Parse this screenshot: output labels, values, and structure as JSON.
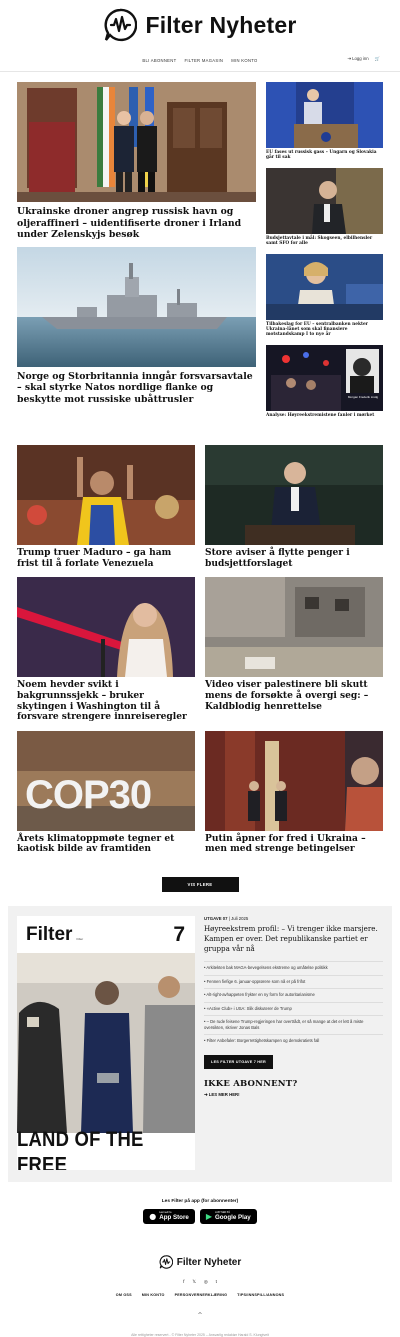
{
  "brand": {
    "name": "Filter Nyheter"
  },
  "nav": {
    "items": [
      "BLI ABONNENT",
      "FILTER MAGASIN",
      "MIN KONTO"
    ],
    "login": "Logg inn"
  },
  "top": {
    "lead": [
      {
        "title": "Ukrainske droner angrep russisk havn og oljeraffineri – uidentifiserte droner i Irland under Zelenskyjs besøk"
      },
      {
        "title": "Norge og Storbritannia inngår forsvarsavtale – skal styrke Natos nordlige flanke og beskytte mot russiske ubåttrusler"
      }
    ],
    "side": [
      {
        "title": "EU fases ut russisk gass – Ungarn og Slovakia går til sak"
      },
      {
        "title": "Budsjettavtale i mål: Skogseen, elbilhensler samt SFO for alle"
      },
      {
        "title": "Tilbakeslag for EU – sentralbanken nekter Ukraina-lånet som skal finansiere motstandskamp I to nye år"
      },
      {
        "title": "Analyse: Høyreekstremistene fanler i mørket",
        "caption": "Morgan Frederik Lindg"
      }
    ]
  },
  "grid": [
    {
      "title": "Trump truer Maduro – ga ham frist til å forlate Venezuela"
    },
    {
      "title": "Store aviser å flytte penger i budsjettforslaget"
    },
    {
      "title": "Noem hevder svikt i bakgrunnssjekk – bruker skytingen i Washington til å forsvare strengere innreiseregler"
    },
    {
      "title": "Video viser palestinere bli skutt mens de forsøkte å overgi seg: – Kaldblodig henrettelse"
    },
    {
      "title": "Årets klimatoppmøte tegner et kaotisk bilde av framtiden",
      "logo": "COP30"
    },
    {
      "title": "Putin åpner for fred i Ukraina – men med strenge betingelser"
    }
  ],
  "more_button": "VIS FLERE",
  "magazine": {
    "cover_brand": "Filter",
    "cover_sub": "Filter",
    "cover_number": "7",
    "cover_banner": "LAND OF THE FREE",
    "issue_label": "UTGAVE 07",
    "issue_date": "Juli 2025",
    "headline": "Høyreekstrem profil: – Vi trenger ikke marsjere. Kampen er over. Det republikanske partiet er gruppa vår nå",
    "toc": [
      "• Arkitekten bak MAGA-bevegelsens ekstreme og umåtelse politikk",
      "• Fennen fiefige 6. januar-opprørere som nå er på frifot",
      "• Alt-right-avhappeten frykter en ny form for autoritarianisme",
      "• «Active Club» i USA: Slik diskuterer de Trump",
      "• – De rude feisene Trump-regjeringen har overtrådt, er så mange at det er lett å miste oversikten, skriver Jonas Bals",
      "• Filter Anbefaler: Borgerrettighetskampen og demokratiets fall"
    ],
    "read_button": "LES FILTER UTGAVE 7 HER",
    "subscribe_title": "IKKE ABONNENT?",
    "subscribe_link": "➜ LES MER HER!"
  },
  "apps": {
    "label": "Les Filter på app (for abonnenter)",
    "app_store_small": "Last ned fra",
    "app_store": "App Store",
    "google_small": "LAST NED PÅ",
    "google": "Google Play"
  },
  "footer": {
    "links": [
      "OM OSS",
      "MIN KONTO",
      "PERSONVERNERKLÆRING",
      "TIPS/INNSPILL/ANNONS"
    ],
    "social": [
      "f",
      "𝕏",
      "◎",
      "t"
    ],
    "up": "^",
    "copyright": "Alle rettigheter reservert - © Filter Nyheter 2025 – Ansvarlig redaktør Harald S. Klungtveit"
  },
  "colors": {
    "accent": "#111111",
    "panel": "#f1f1f1"
  }
}
